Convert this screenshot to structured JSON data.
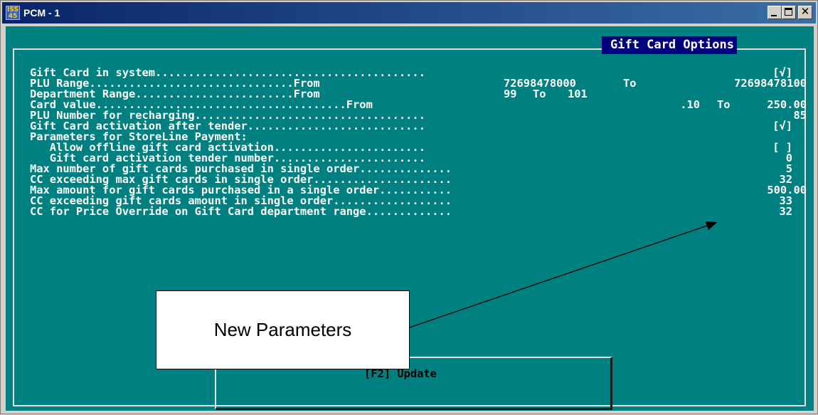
{
  "window": {
    "title": "PCM - 1",
    "icon_text": "ISS\n45"
  },
  "panel": {
    "title": "Gift Card Options"
  },
  "rows": [
    {
      "label": "Gift Card in system.........................................",
      "value": "[√]"
    },
    {
      "label": "PLU Range...............................From",
      "value_from": "72698478000",
      "to_text": "To",
      "value_to": "72698478100"
    },
    {
      "label": "Department Range........................From",
      "value_from": "99",
      "to_text": "To",
      "value_to": "101"
    },
    {
      "label": "Card value......................................From",
      "value_from": ".10",
      "to_text": "To",
      "value_to": "250.00"
    },
    {
      "label": "PLU Number for recharging...................................",
      "value": "85"
    },
    {
      "label": "Gift Card activation after tender...........................",
      "value": "[√]"
    },
    {
      "label": "Parameters for StoreLine Payment:",
      "value": ""
    },
    {
      "label": "   Allow offline gift card activation.......................",
      "value": "[ ]"
    },
    {
      "label": "   Gift card activation tender number.......................",
      "value": "0"
    },
    {
      "label": "Max number of gift cards purchased in single order..............",
      "value": "5"
    },
    {
      "label": "CC exceeding max gift cards in single order.....................",
      "value": "32"
    },
    {
      "label": "Max amount for gift cards purchased in a single order...........",
      "value": "500.00"
    },
    {
      "label": "CC exceeding gift cards amount in single order..................",
      "value": "33"
    },
    {
      "label": "CC for Price Override on Gift Card department range.............",
      "value": "32"
    }
  ],
  "callout": {
    "text": "New Parameters"
  },
  "footer": {
    "update_label": "[F2] Update"
  },
  "colors": {
    "console_bg": "#008080",
    "panel_title_bg": "#00007f",
    "titlebar": "#0a246a"
  }
}
